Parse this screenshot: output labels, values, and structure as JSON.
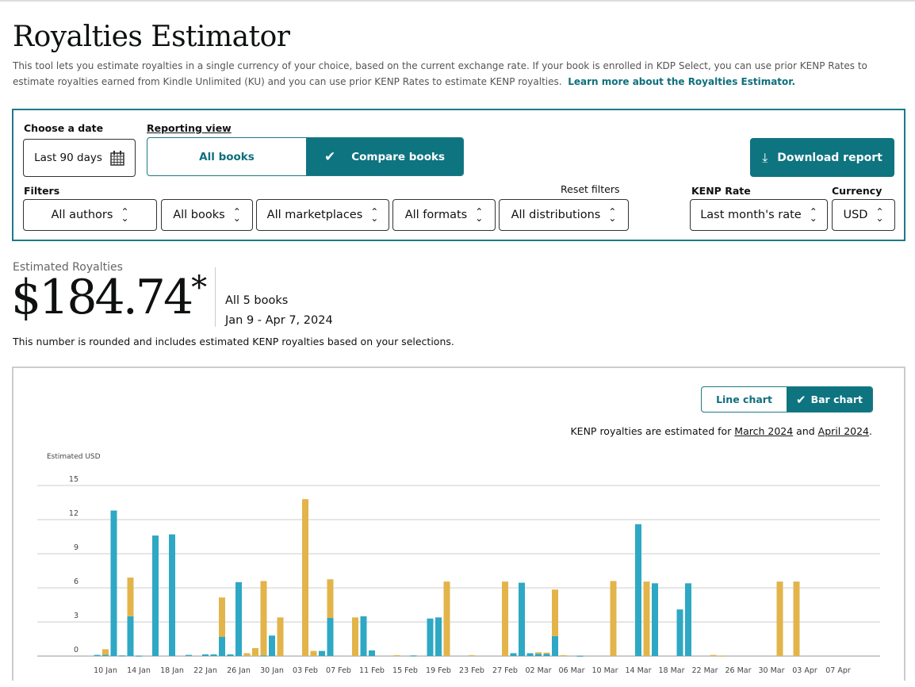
{
  "header": {
    "title": "Royalties Estimator",
    "description": "This tool lets you estimate royalties in a single currency of your choice, based on the current exchange rate. If your book is enrolled in KDP Select, you can use prior KENP Rates to estimate royalties earned from Kindle Unlimited (KU) and you can use prior KENP Rates to estimate KENP royalties.",
    "learn_more": "Learn more about the Royalties Estimator."
  },
  "controls": {
    "date_label": "Choose a date",
    "date_value": "Last 90 days",
    "reporting_label": "Reporting view",
    "view_all": "All books",
    "view_compare": "Compare books",
    "view_selected": "Compare books",
    "download": "Download report",
    "filters_label": "Filters",
    "reset": "Reset filters",
    "filters": [
      "All authors",
      "All books",
      "All marketplaces",
      "All formats",
      "All distributions"
    ],
    "kenp_label": "KENP Rate",
    "kenp_value": "Last month's rate",
    "currency_label": "Currency",
    "currency_value": "USD",
    "accent": "#0e7480"
  },
  "summary": {
    "label": "Estimated Royalties",
    "amount": "$184.74",
    "asterisk": "*",
    "books": "All 5 books",
    "range": "Jan 9 - Apr 7, 2024",
    "note": "This number is rounded and includes estimated KENP royalties based on your selections."
  },
  "chart_toggle": {
    "line": "Line chart",
    "bar": "Bar chart",
    "selected": "Bar chart"
  },
  "kenp_note": {
    "prefix": "KENP royalties are estimated for ",
    "m1": "March 2024",
    "mid": " and ",
    "m2": "April 2024",
    "suffix": "."
  },
  "chart_data": {
    "type": "bar",
    "stacked": true,
    "ylabel": "Estimated USD",
    "ylim": [
      0,
      15
    ],
    "yticks": [
      "0",
      "3",
      "6",
      "9",
      "12",
      "15"
    ],
    "xticks": [
      "10 Jan",
      "14 Jan",
      "18 Jan",
      "22 Jan",
      "26 Jan",
      "30 Jan",
      "03 Feb",
      "07 Feb",
      "11 Feb",
      "15 Feb",
      "19 Feb",
      "23 Feb",
      "27 Feb",
      "02 Mar",
      "06 Mar",
      "10 Mar",
      "14 Mar",
      "18 Mar",
      "22 Mar",
      "26 Mar",
      "30 Mar",
      "03 Apr",
      "07 Apr"
    ],
    "grid": true,
    "series": [
      {
        "color": "#2ea8c4",
        "points": [
          [
            "2024-01-09",
            0.1
          ],
          [
            "2024-01-10",
            0.1
          ],
          [
            "2024-01-11",
            12.8
          ],
          [
            "2024-01-12",
            0.05
          ],
          [
            "2024-01-13",
            3.5
          ],
          [
            "2024-01-14",
            0.03
          ],
          [
            "2024-01-16",
            10.6
          ],
          [
            "2024-01-18",
            10.7
          ],
          [
            "2024-01-20",
            0.1
          ],
          [
            "2024-01-22",
            0.15
          ],
          [
            "2024-01-23",
            0.15
          ],
          [
            "2024-01-24",
            1.7
          ],
          [
            "2024-01-25",
            0.15
          ],
          [
            "2024-01-26",
            6.5
          ],
          [
            "2024-01-29",
            0.05
          ],
          [
            "2024-01-30",
            1.8
          ],
          [
            "2024-02-05",
            0.45
          ],
          [
            "2024-02-06",
            3.35
          ],
          [
            "2024-02-10",
            3.5
          ],
          [
            "2024-02-11",
            0.5
          ],
          [
            "2024-02-16",
            0.05
          ],
          [
            "2024-02-18",
            3.3
          ],
          [
            "2024-02-19",
            3.4
          ],
          [
            "2024-02-28",
            0.25
          ],
          [
            "2024-02-29",
            6.45
          ],
          [
            "2024-03-01",
            0.25
          ],
          [
            "2024-03-02",
            0.2
          ],
          [
            "2024-03-03",
            0.2
          ],
          [
            "2024-03-04",
            1.75
          ],
          [
            "2024-03-07",
            0.02
          ],
          [
            "2024-03-14",
            11.6
          ],
          [
            "2024-03-16",
            6.4
          ],
          [
            "2024-03-19",
            4.1
          ],
          [
            "2024-03-20",
            6.4
          ]
        ]
      },
      {
        "color": "#e2b44a",
        "points": [
          [
            "2024-01-10",
            0.5
          ],
          [
            "2024-01-13",
            3.4
          ],
          [
            "2024-01-24",
            3.45
          ],
          [
            "2024-01-27",
            0.25
          ],
          [
            "2024-01-28",
            0.7
          ],
          [
            "2024-01-29",
            6.55
          ],
          [
            "2024-01-31",
            3.4
          ],
          [
            "2024-02-03",
            13.8
          ],
          [
            "2024-02-04",
            0.45
          ],
          [
            "2024-02-06",
            3.4
          ],
          [
            "2024-02-09",
            3.4
          ],
          [
            "2024-02-14",
            0.08
          ],
          [
            "2024-02-20",
            6.55
          ],
          [
            "2024-02-23",
            0.08
          ],
          [
            "2024-02-27",
            6.55
          ],
          [
            "2024-03-02",
            0.13
          ],
          [
            "2024-03-03",
            0.1
          ],
          [
            "2024-03-04",
            4.1
          ],
          [
            "2024-03-05",
            0.08
          ],
          [
            "2024-03-11",
            6.6
          ],
          [
            "2024-03-15",
            6.55
          ],
          [
            "2024-03-23",
            0.1
          ],
          [
            "2024-03-24",
            0.03
          ],
          [
            "2024-03-31",
            6.55
          ],
          [
            "2024-04-02",
            6.55
          ]
        ]
      }
    ]
  }
}
